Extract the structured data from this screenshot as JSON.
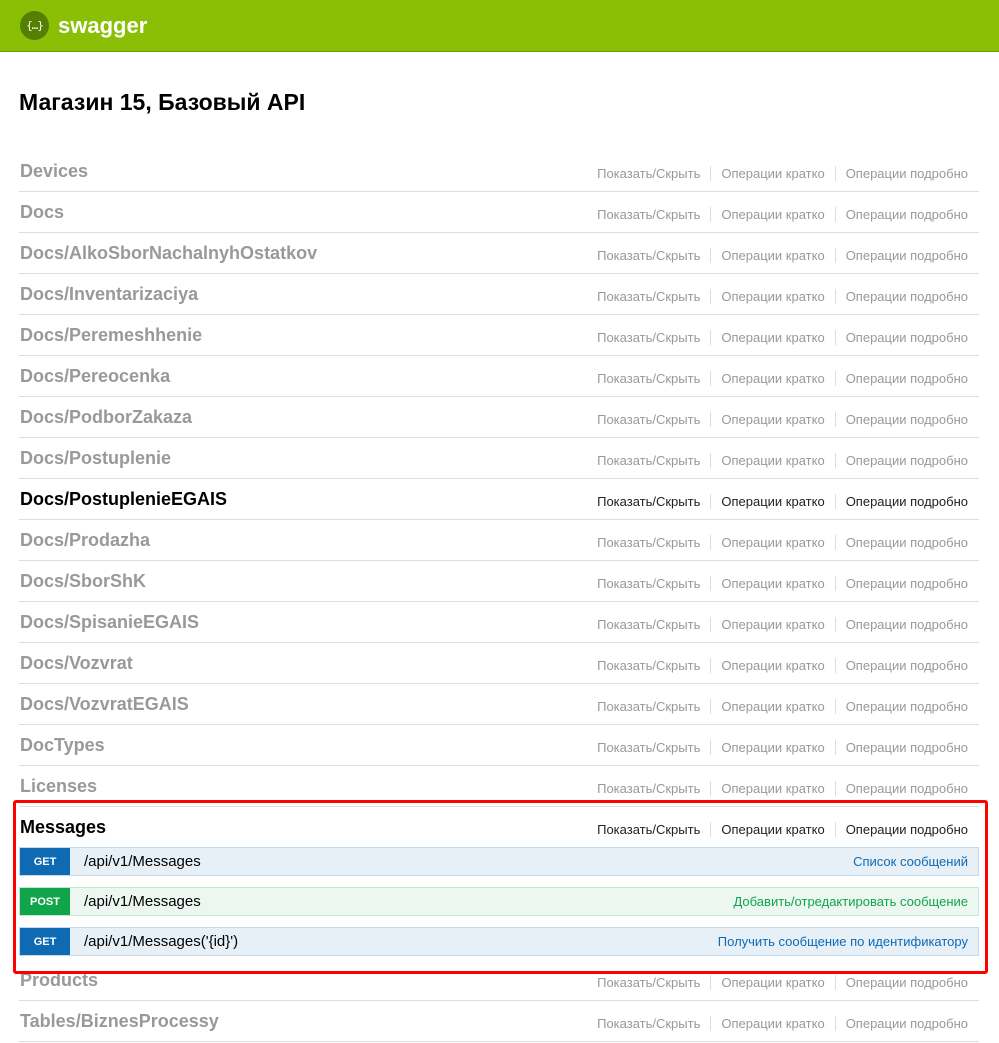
{
  "header": {
    "logo_glyph": "{…}",
    "brand": "swagger",
    "brand_color": "#89bf04"
  },
  "page_title": "Магазин 15, Базовый API",
  "resource_actions": {
    "show_hide": "Показать/Скрыть",
    "list_ops": "Операции кратко",
    "expand_ops": "Операции подробно"
  },
  "resources": [
    {
      "name": "Devices"
    },
    {
      "name": "Docs"
    },
    {
      "name": "Docs/AlkoSborNachalnyhOstatkov"
    },
    {
      "name": "Docs/Inventarizaciya"
    },
    {
      "name": "Docs/Peremeshhenie"
    },
    {
      "name": "Docs/Pereocenka"
    },
    {
      "name": "Docs/PodborZakaza"
    },
    {
      "name": "Docs/Postuplenie"
    },
    {
      "name": "Docs/PostuplenieEGAIS"
    },
    {
      "name": "Docs/Prodazha"
    },
    {
      "name": "Docs/SborShK"
    },
    {
      "name": "Docs/SpisanieEGAIS"
    },
    {
      "name": "Docs/Vozvrat"
    },
    {
      "name": "Docs/VozvratEGAIS"
    },
    {
      "name": "DocTypes"
    },
    {
      "name": "Licenses"
    },
    {
      "name": "Messages"
    },
    {
      "name": "Products"
    },
    {
      "name": "Tables/BiznesProcessy"
    }
  ],
  "messages_operations": [
    {
      "method": "GET",
      "path": "/api/v1/Messages",
      "summary": "Список сообщений"
    },
    {
      "method": "POST",
      "path": "/api/v1/Messages",
      "summary": "Добавить/отредактировать сообщение"
    },
    {
      "method": "GET",
      "path": "/api/v1/Messages('{id}')",
      "summary": "Получить сообщение по идентификатору"
    }
  ],
  "colors": {
    "get": "#0f6ab4",
    "post": "#10a54a",
    "highlight": "#ff0000"
  }
}
